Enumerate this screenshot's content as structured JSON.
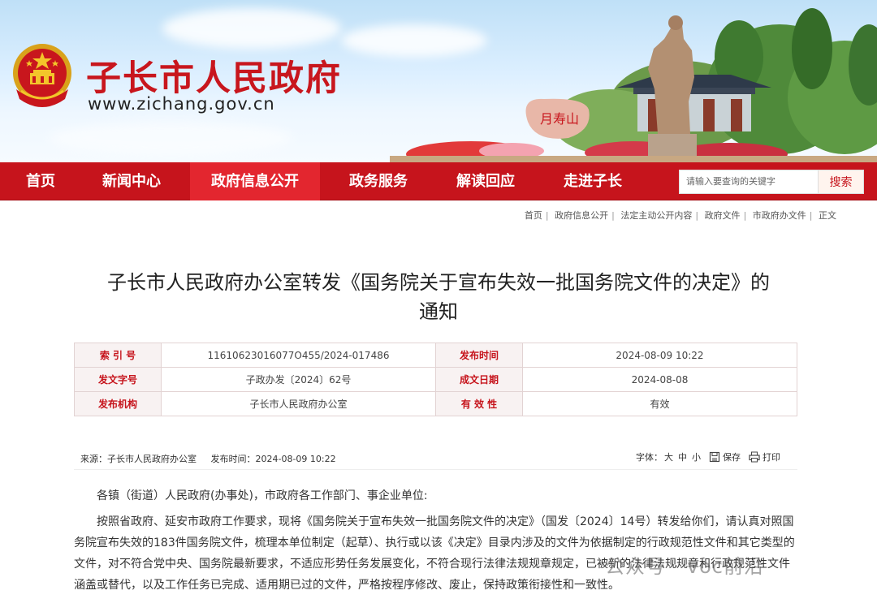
{
  "site": {
    "title": "子长市人民政府",
    "url": "www.zichang.gov.cn"
  },
  "nav": {
    "items": [
      {
        "label": "首页"
      },
      {
        "label": "新闻中心"
      },
      {
        "label": "政府信息公开"
      },
      {
        "label": "政务服务"
      },
      {
        "label": "解读回应"
      },
      {
        "label": "走进子长"
      }
    ],
    "active": "政府信息公开"
  },
  "search": {
    "placeholder": "请输入要查询的关键字",
    "button": "搜索"
  },
  "breadcrumb": [
    "首页",
    "政府信息公开",
    "法定主动公开内容",
    "政府文件",
    "市政府办文件",
    "正文"
  ],
  "doc": {
    "title_line1": "子长市人民政府办公室转发《国务院关于宣布失效一批国务院文件的决定》的",
    "title_line2": "通知"
  },
  "info": {
    "index_label": "索 引 号",
    "index_value": "11610623016077O455/2024-017486",
    "pubtime_label": "发布时间",
    "pubtime_value": "2024-08-09 10:22",
    "docno_label": "发文字号",
    "docno_value": "子政办发〔2024〕62号",
    "date_label": "成文日期",
    "date_value": "2024-08-08",
    "org_label": "发布机构",
    "org_value": "子长市人民政府办公室",
    "valid_label": "有 效 性",
    "valid_value": "有效"
  },
  "meta": {
    "source": "来源：子长市人民政府办公室",
    "pubtime": "发布时间：2024-08-09 10:22",
    "font_label": "字体：",
    "font_large": "大",
    "font_mid": "中",
    "font_small": "小",
    "save": "保存",
    "print": "打印"
  },
  "body": {
    "salutation": "各镇（街道）人民政府(办事处)，市政府各工作部门、事企业单位:",
    "para1": "按照省政府、延安市政府工作要求，现将《国务院关于宣布失效一批国务院文件的决定》（国发〔2024〕14号）转发给你们，请认真对照国务院宣布失效的183件国务院文件，梳理本单位制定（起草）、执行或以该《决定》目录内涉及的文件为依据制定的行政规范性文件和其它类型的文件，对不符合党中央、国务院最新要求，不适应形势任务发展变化，不符合现行法律法规规章规定，已被新的法律法规规章和行政规范性文件涵盖或替代，以及工作任务已完成、适用期已过的文件，严格按程序修改、废止，保持政策衔接性和一致性。"
  },
  "watermark": "公众号 · voc前沿",
  "colors": {
    "brand_red": "#c6141c",
    "active_nav": "#e3262f"
  }
}
